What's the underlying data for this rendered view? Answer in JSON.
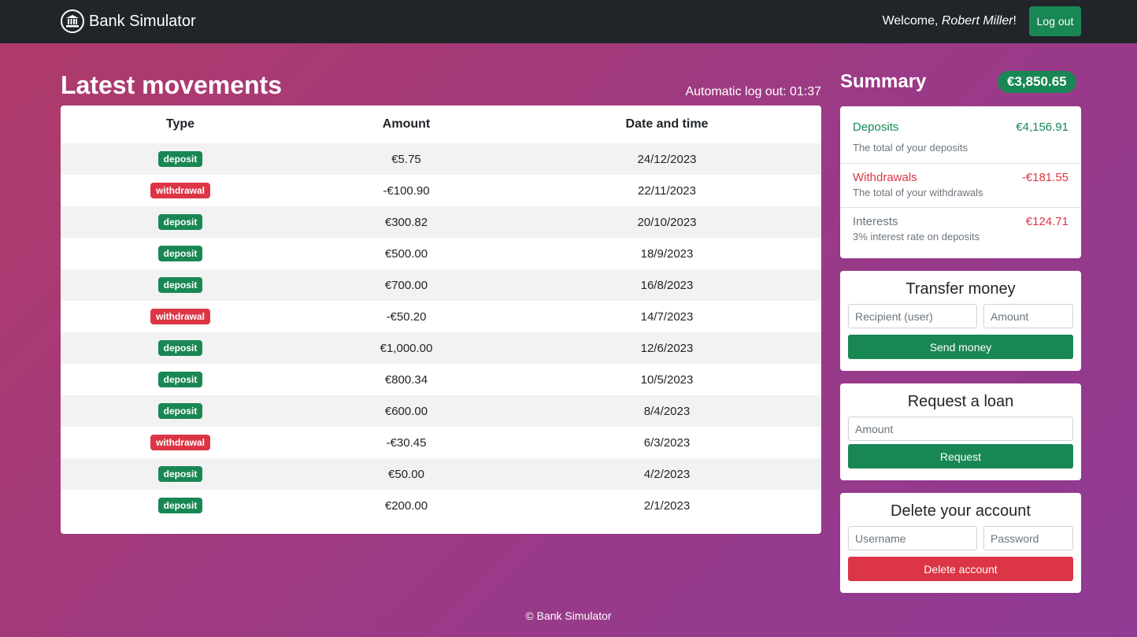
{
  "navbar": {
    "brand": "Bank Simulator",
    "welcome_prefix": "Welcome, ",
    "user_name": "Robert Miller",
    "welcome_suffix": "!",
    "logout_label": "Log out"
  },
  "movements": {
    "title": "Latest movements",
    "auto_logout_label": "Automatic log out: ",
    "auto_logout_time": "01:37",
    "columns": [
      "Type",
      "Amount",
      "Date and time"
    ],
    "rows": [
      {
        "type": "deposit",
        "amount": "€5.75",
        "date": "24/12/2023"
      },
      {
        "type": "withdrawal",
        "amount": "-€100.90",
        "date": "22/11/2023"
      },
      {
        "type": "deposit",
        "amount": "€300.82",
        "date": "20/10/2023"
      },
      {
        "type": "deposit",
        "amount": "€500.00",
        "date": "18/9/2023"
      },
      {
        "type": "deposit",
        "amount": "€700.00",
        "date": "16/8/2023"
      },
      {
        "type": "withdrawal",
        "amount": "-€50.20",
        "date": "14/7/2023"
      },
      {
        "type": "deposit",
        "amount": "€1,000.00",
        "date": "12/6/2023"
      },
      {
        "type": "deposit",
        "amount": "€800.34",
        "date": "10/5/2023"
      },
      {
        "type": "deposit",
        "amount": "€600.00",
        "date": "8/4/2023"
      },
      {
        "type": "withdrawal",
        "amount": "-€30.45",
        "date": "6/3/2023"
      },
      {
        "type": "deposit",
        "amount": "€50.00",
        "date": "4/2/2023"
      },
      {
        "type": "deposit",
        "amount": "€200.00",
        "date": "2/1/2023"
      }
    ]
  },
  "summary": {
    "title": "Summary",
    "balance": "€3,850.65",
    "deposits": {
      "label": "Deposits",
      "value": "€4,156.91",
      "desc": "The total of your deposits"
    },
    "withdrawals": {
      "label": "Withdrawals",
      "value": "-€181.55",
      "desc": "The total of your withdrawals"
    },
    "interests": {
      "label": "Interests",
      "value": "€124.71",
      "desc": "3% interest rate on deposits"
    }
  },
  "transfer": {
    "title": "Transfer money",
    "recipient_placeholder": "Recipient (user)",
    "amount_placeholder": "Amount",
    "button": "Send money"
  },
  "loan": {
    "title": "Request a loan",
    "amount_placeholder": "Amount",
    "button": "Request"
  },
  "delete": {
    "title": "Delete your account",
    "username_placeholder": "Username",
    "password_placeholder": "Password",
    "button": "Delete account"
  },
  "footer": "© Bank Simulator",
  "colors": {
    "success": "#198754",
    "danger": "#dc3545",
    "navbar": "#212529"
  },
  "icons": {
    "brand": "bank-icon"
  }
}
